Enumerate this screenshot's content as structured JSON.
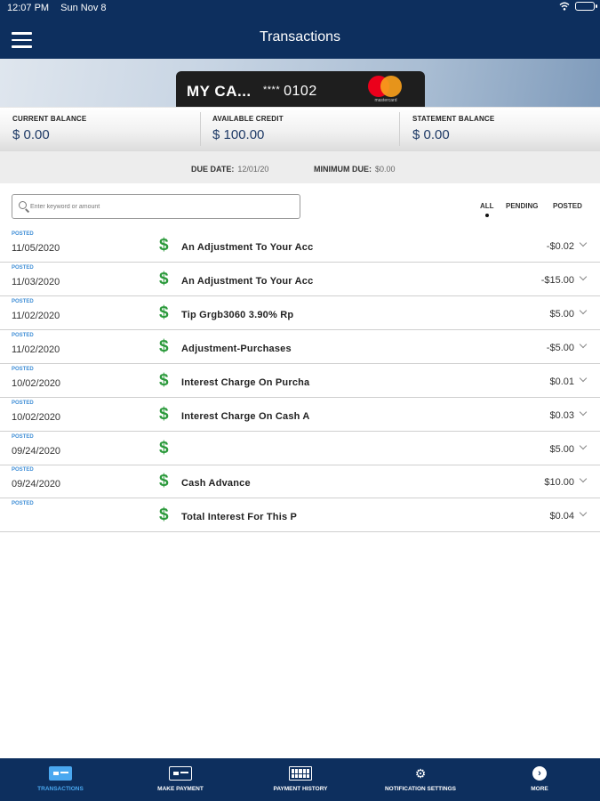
{
  "status_bar": {
    "time": "12:07 PM",
    "date": "Sun Nov 8"
  },
  "header": {
    "title": "Transactions"
  },
  "card": {
    "name": "MY CA...",
    "masked_number": "****",
    "last_digits": "0102",
    "brand_text": "mastercard"
  },
  "balances": {
    "current_label": "CURRENT BALANCE",
    "current_value": "$ 0.00",
    "available_label": "AVAILABLE CREDIT",
    "available_value": "$ 100.00",
    "statement_label": "STATEMENT BALANCE",
    "statement_value": "$ 0.00"
  },
  "due": {
    "due_date_label": "DUE DATE:",
    "due_date_value": "12/01/20",
    "minimum_due_label": "MINIMUM DUE:",
    "minimum_due_value": "$0.00"
  },
  "search": {
    "placeholder": "Enter keyword or amount"
  },
  "filters": {
    "all": "ALL",
    "pending": "PENDING",
    "posted": "POSTED",
    "selected": "ALL"
  },
  "transactions": [
    {
      "status": "POSTED",
      "date": "11/05/2020",
      "description": "An Adjustment To Your Acc",
      "amount": "-$0.02"
    },
    {
      "status": "POSTED",
      "date": "11/03/2020",
      "description": "An Adjustment To Your Acc",
      "amount": "-$15.00"
    },
    {
      "status": "POSTED",
      "date": "11/02/2020",
      "description": "Tip Grgb3060 3.90% Rp",
      "amount": "$5.00"
    },
    {
      "status": "POSTED",
      "date": "11/02/2020",
      "description": "Adjustment-Purchases",
      "amount": "-$5.00"
    },
    {
      "status": "POSTED",
      "date": "10/02/2020",
      "description": "Interest Charge On Purcha",
      "amount": "$0.01"
    },
    {
      "status": "POSTED",
      "date": "10/02/2020",
      "description": "Interest Charge On Cash A",
      "amount": "$0.03"
    },
    {
      "status": "POSTED",
      "date": "09/24/2020",
      "description": "",
      "amount": "$5.00"
    },
    {
      "status": "POSTED",
      "date": "09/24/2020",
      "description": "Cash Advance",
      "amount": "$10.00"
    },
    {
      "status": "POSTED",
      "date": "",
      "description": "Total Interest For This P",
      "amount": "$0.04"
    }
  ],
  "dollar_symbol": "$",
  "bottom_nav": [
    {
      "label": "TRANSACTIONS",
      "icon": "card-icon",
      "active": true
    },
    {
      "label": "MAKE PAYMENT",
      "icon": "payment-card-icon",
      "active": false
    },
    {
      "label": "PAYMENT HISTORY",
      "icon": "calendar-icon",
      "active": false
    },
    {
      "label": "NOTIFICATION SETTINGS",
      "icon": "gear-chat-icon",
      "active": false
    },
    {
      "label": "MORE",
      "icon": "more-arrow-icon",
      "active": false
    }
  ],
  "colors": {
    "nav_bg": "#0d2f5e",
    "accent": "#4aa8f0",
    "dollar_green": "#2c9a3c",
    "posted_blue": "#3f8ed6"
  }
}
